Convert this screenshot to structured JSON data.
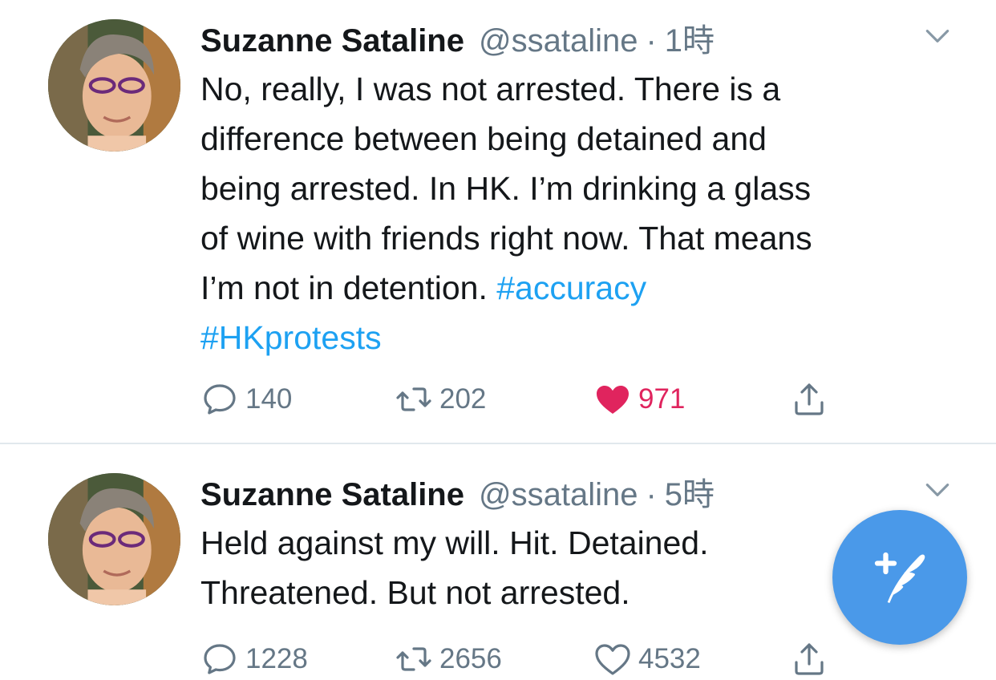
{
  "tweets": [
    {
      "name": "Suzanne Sataline",
      "handle": "@ssataline",
      "separator": "·",
      "time": "1時",
      "text_lines": [
        "No, really, I was not arrested. There is a",
        "difference between being detained and",
        "being arrested. In HK. I’m drinking a glass",
        "of wine with friends right now. That means",
        "I’m not in detention. "
      ],
      "hashtags": [
        "#accuracy",
        "#HKprotests"
      ],
      "replies": "140",
      "retweets": "202",
      "likes": "971",
      "liked": true
    },
    {
      "name": "Suzanne Sataline",
      "handle": "@ssataline",
      "separator": "·",
      "time": "5時",
      "text_lines": [
        "Held against my will. Hit. Detained.",
        "Threatened. But not arrested."
      ],
      "replies": "1228",
      "retweets": "2656",
      "likes": "4532",
      "liked": false
    }
  ],
  "icons": {
    "reply": "speech-bubble-icon",
    "retweet": "retweet-arrows-icon",
    "like_filled": "heart-filled-icon",
    "like_outline": "heart-outline-icon",
    "share": "share-upload-icon",
    "caret": "chevron-down-icon",
    "compose": "compose-feather-plus-icon"
  },
  "colors": {
    "link": "#1da1f2",
    "like": "#e0245e",
    "secondary_text": "#657786",
    "fab": "#4a99e9"
  }
}
